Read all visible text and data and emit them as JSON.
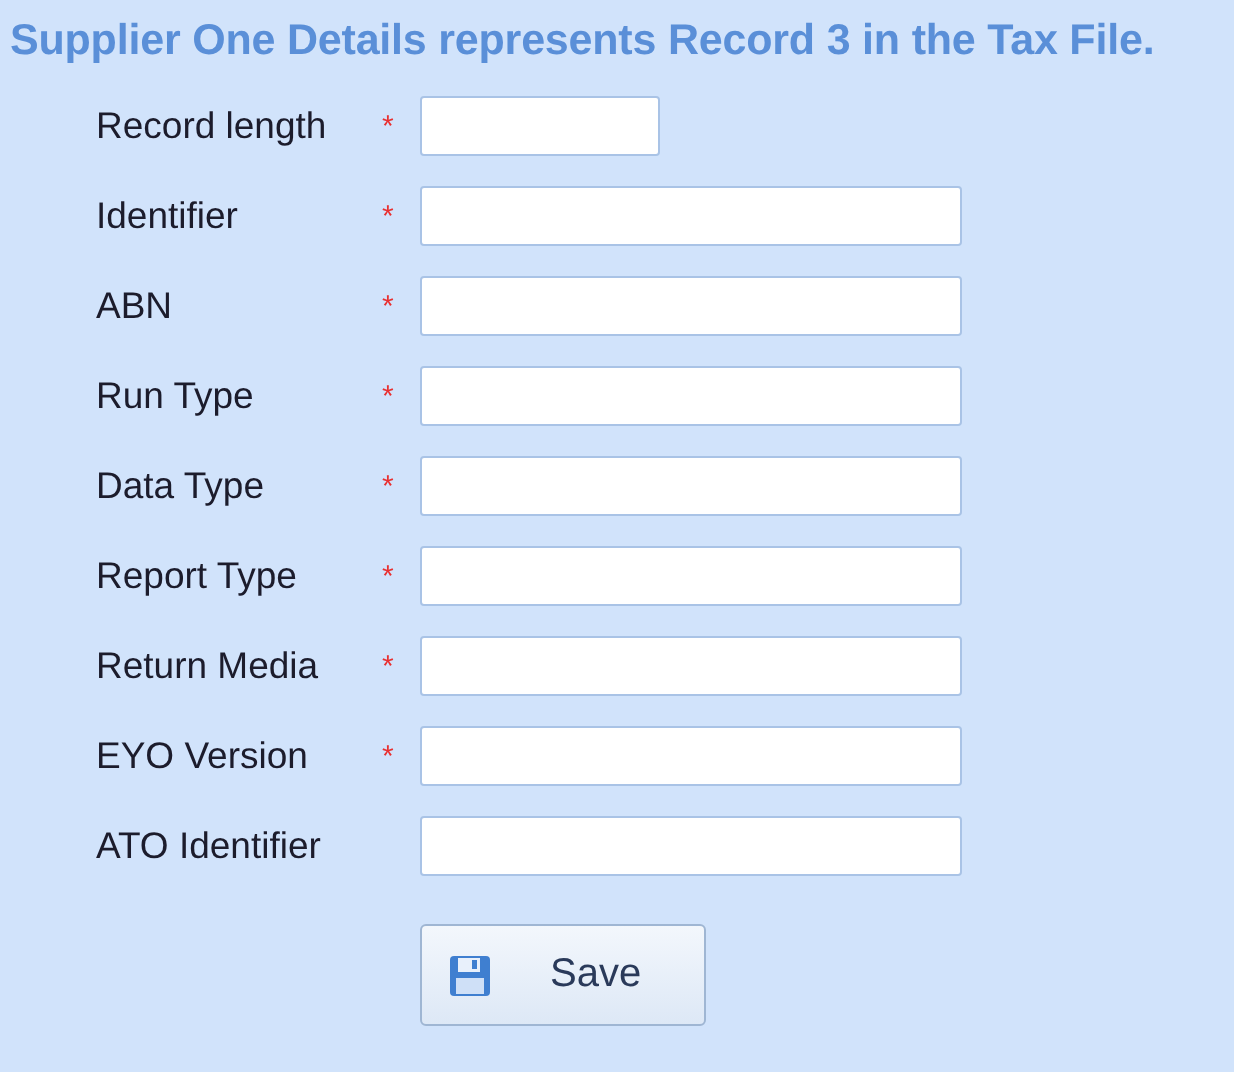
{
  "title": "Supplier One Details represents Record 3 in the Tax File.",
  "fields": [
    {
      "label": "Record length",
      "required": true,
      "kind": "short"
    },
    {
      "label": "Identifier",
      "required": true,
      "kind": "long"
    },
    {
      "label": "ABN",
      "required": true,
      "kind": "long"
    },
    {
      "label": "Run Type",
      "required": true,
      "kind": "long"
    },
    {
      "label": "Data Type",
      "required": true,
      "kind": "long"
    },
    {
      "label": "Report Type",
      "required": true,
      "kind": "long"
    },
    {
      "label": "Return Media",
      "required": true,
      "kind": "long"
    },
    {
      "label": "EYO Version",
      "required": true,
      "kind": "long"
    },
    {
      "label": "ATO Identifier",
      "required": false,
      "kind": "long"
    }
  ],
  "required_mark": "*",
  "save_button": {
    "label": "Save"
  }
}
